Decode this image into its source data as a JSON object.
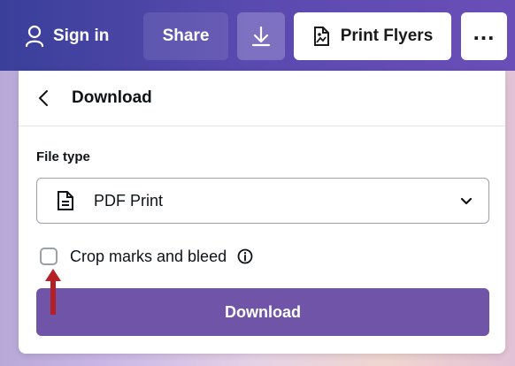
{
  "topbar": {
    "sign_in_label": "Sign in",
    "share_label": "Share",
    "print_label": "Print Flyers",
    "more_label": "..."
  },
  "panel": {
    "title": "Download",
    "file_type_label": "File type",
    "file_type_value": "PDF Print",
    "crop_marks_label": "Crop marks and bleed",
    "crop_marks_checked": false,
    "download_label": "Download"
  },
  "colors": {
    "topbar_start": "#3a3f9a",
    "topbar_end": "#6b4eb8",
    "download_button": "#6f54a8",
    "annotation_arrow": "#b52026"
  },
  "icons": [
    "user-icon",
    "download-arrow-icon",
    "print-doc-icon",
    "more-icon",
    "chevron-left-icon",
    "pdf-doc-icon",
    "chevron-down-icon",
    "info-icon",
    "annotation-arrow-icon"
  ]
}
